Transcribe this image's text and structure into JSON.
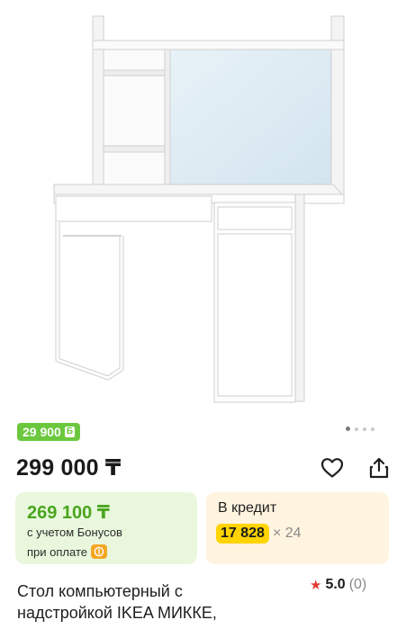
{
  "gallery": {
    "dots_total": 4,
    "active_index": 0
  },
  "bonus_badge": {
    "amount": "29 900",
    "icon_text": "Б"
  },
  "price": {
    "main": "299 000 ₸"
  },
  "icons": {
    "favorite": "heart-icon",
    "share": "share-icon"
  },
  "bonus_card": {
    "price": "269 100 ₸",
    "line1": "с учетом Бонусов",
    "line2": "при оплате"
  },
  "credit_card": {
    "title": "В кредит",
    "amount": "17 828",
    "months": "× 24"
  },
  "product": {
    "title": "Стол компьютерный с надстройкой IKEA МИККЕ,"
  },
  "rating": {
    "value": "5.0",
    "count": "(0)"
  },
  "colors": {
    "bonus_green": "#6bc83e",
    "bonus_card_bg": "#e9f8dd",
    "credit_card_bg": "#fff4df",
    "credit_highlight": "#ffd400",
    "star": "#e53935"
  }
}
